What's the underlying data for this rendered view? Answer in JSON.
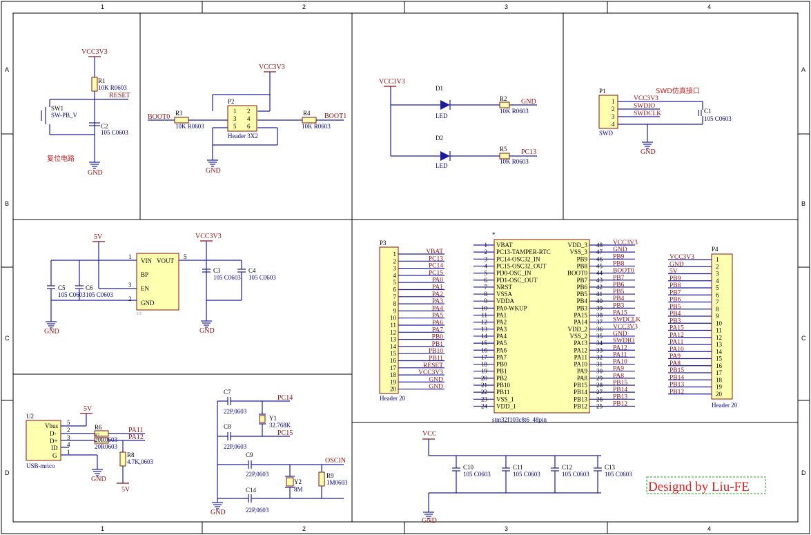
{
  "frame": {
    "cols": [
      "1",
      "2",
      "3",
      "4"
    ],
    "rows": [
      "A",
      "B",
      "C",
      "D"
    ]
  },
  "reset": {
    "vcc": "VCC3V3",
    "r_des": "R1",
    "r_val": "10K R0603",
    "net": "RESET",
    "sw_des": "SW1",
    "sw_val": "SW-PB_V",
    "c_des": "C2",
    "c_val": "105 C0603",
    "label": "复位电路",
    "gnd": "GND"
  },
  "boot": {
    "vcc": "VCC3V3",
    "net0": "BOOT0",
    "r3_des": "R3",
    "r3_val": "10K R0603",
    "p2_des": "P2",
    "p2_val": "Header 3X2",
    "pins": [
      "1",
      "2",
      "3",
      "4",
      "5",
      "6"
    ],
    "r4_des": "R4",
    "r4_val": "10K R0603",
    "net1": "BOOT1",
    "gnd": "GND"
  },
  "leds": {
    "vcc": "VCC3V3",
    "d1_des": "D1",
    "d1_val": "LED",
    "r2_des": "R2",
    "r2_val": "10K R0603",
    "r2_net": "GND",
    "d2_des": "D2",
    "d2_val": "LED",
    "r5_des": "R5",
    "r5_val": "10K R0603",
    "r5_net": "PC13"
  },
  "swd": {
    "title": "SWD仿真接口",
    "p1_des": "P1",
    "p1_val": "SWD",
    "pins": [
      "1",
      "2",
      "3",
      "4"
    ],
    "nets": [
      "VCC3V3",
      "SWDIO",
      "SWDCLK"
    ],
    "c1_des": "C1",
    "c1_val": "105 C0603",
    "gnd": "GND"
  },
  "ldo": {
    "v5": "5V",
    "vcc": "VCC3V3",
    "pin_vin": "VIN",
    "pin_vout": "VOUT",
    "pin_bp": "BP",
    "pin_en": "EN",
    "pin_gnd": "GND",
    "pin1": "1",
    "pin2": "2",
    "pin3": "3",
    "pin5": "5",
    "c5_des": "C5",
    "c5_val": "105 C0603",
    "c6_des": "C6",
    "c6_val": "105 C0603",
    "c3_des": "C3",
    "c3_val": "105 C0603",
    "c4_des": "C4",
    "c4_val": "105 C0603",
    "gnd": "GND",
    "u1": "U1"
  },
  "usb": {
    "u2_des": "U2",
    "u2_val": "USB-mrico",
    "pins": [
      "Vbus",
      "D-",
      "D+",
      "ID",
      "G"
    ],
    "pinnums": [
      "5",
      "2",
      "3",
      "4",
      "1"
    ],
    "v5": "5V",
    "r6_des": "R6",
    "r6_val": "20R0603",
    "r7_des": "R7",
    "r7_val": "20R0603",
    "pa11": "PA11",
    "pa12": "PA12",
    "r8_des": "R8",
    "r8_val": "4.7K,0603",
    "v5b": "5V",
    "gnd": "GND"
  },
  "xtal": {
    "c7_des": "C7",
    "c7_val": "22P,0603",
    "c8_des": "C8",
    "c8_val": "22P,0603",
    "y1_des": "Y1",
    "y1_val": "32.768K",
    "pc14": "PC14",
    "pc15": "PC15",
    "c9_des": "C9",
    "c9_val": "22P,0603",
    "c14_des": "C14",
    "c14_val": "22P,0603",
    "y2_des": "Y2",
    "y2_val": "8M",
    "r9_des": "R9",
    "r9_val": "1M0603",
    "oscin": "OSCIN",
    "gnd": "GND"
  },
  "p3": {
    "des": "P3",
    "val": "Header 20",
    "pins": [
      "1",
      "2",
      "3",
      "4",
      "5",
      "6",
      "7",
      "8",
      "9",
      "10",
      "11",
      "12",
      "13",
      "14",
      "15",
      "16",
      "17",
      "18",
      "19",
      "20"
    ],
    "nets": [
      "VBAT",
      "PC13",
      "PC14",
      "PC15",
      "PA0",
      "PA1",
      "PA2",
      "PA3",
      "PA4",
      "PA5",
      "PA6",
      "PA7",
      "PB0",
      "PB1",
      "PB10",
      "PB11",
      "RESET",
      "VCC3V3",
      "GND",
      "GND"
    ]
  },
  "mcu": {
    "val": "stm32f103c8t6_48pin",
    "left_nums": [
      "1",
      "2",
      "3",
      "4",
      "5",
      "6",
      "7",
      "8",
      "9",
      "10",
      "11",
      "12",
      "13",
      "14",
      "15",
      "16",
      "17",
      "18",
      "19",
      "20",
      "21",
      "22",
      "23",
      "24"
    ],
    "left_pins": [
      "VBAT",
      "PC13-TAMPER-RTC",
      "PC14-OSC32_IN",
      "PC15-OSC32_OUT",
      "PD0-OSC_IN",
      "PD1-OSC_OUT",
      "NRST",
      "VSSA",
      "VDDA",
      "PA0-WKUP",
      "PA1",
      "PA2",
      "PA3",
      "PA4",
      "PA5",
      "PA6",
      "PA7",
      "PB0",
      "PB1",
      "PB2",
      "PB10",
      "PB11",
      "VSS_1",
      "VDD_1"
    ],
    "right_pins": [
      "VDD_3",
      "VSS_3",
      "PB9",
      "PB8",
      "BOOT0",
      "PB7",
      "PB6",
      "PB5",
      "PB4",
      "PB3",
      "PA15",
      "PA14",
      "VDD_2",
      "VSS_2",
      "PA13",
      "PA12",
      "PA11",
      "PA10",
      "PA9",
      "PA8",
      "PB15",
      "PB14",
      "PB13",
      "PB12"
    ],
    "right_nums": [
      "48",
      "47",
      "46",
      "45",
      "44",
      "43",
      "42",
      "41",
      "40",
      "39",
      "38",
      "37",
      "36",
      "35",
      "34",
      "33",
      "32",
      "31",
      "30",
      "29",
      "28",
      "27",
      "26",
      "25"
    ],
    "right_nets": [
      "VCC3V3",
      "GND",
      "PB9",
      "PB8",
      "BOOT0",
      "PB7",
      "PB6",
      "PB5",
      "PB4",
      "PB3",
      "PA15",
      "SWDCLK",
      "VCC3V3",
      "GND",
      "SWDIO",
      "PA12",
      "PA11",
      "PA10",
      "PA9",
      "PA8",
      "PB15",
      "PB14",
      "PB13",
      "PB12"
    ]
  },
  "p4": {
    "des": "P4",
    "val": "Header 20",
    "pins": [
      "1",
      "2",
      "3",
      "4",
      "5",
      "6",
      "7",
      "8",
      "9",
      "10",
      "11",
      "12",
      "13",
      "14",
      "15",
      "16",
      "17",
      "18",
      "19",
      "20"
    ],
    "nets": [
      "VCC3V3",
      "GND",
      "5V",
      "PB9",
      "PB8",
      "PB7",
      "PB6",
      "PB5",
      "PB4",
      "PB3",
      "PA15",
      "PA12",
      "PA11",
      "PA10",
      "PA9",
      "PA8",
      "PB15",
      "PB14",
      "PB13",
      "PB12"
    ]
  },
  "decap": {
    "vcc": "VCC",
    "caps": [
      {
        "des": "C10",
        "val": "105 C0603"
      },
      {
        "des": "C11",
        "val": "105 C0603"
      },
      {
        "des": "C12",
        "val": "105 C0603"
      },
      {
        "des": "C13",
        "val": "105 C0603"
      }
    ],
    "gnd": "GND"
  },
  "credit": "Designd by Liu-FE",
  "colors": {
    "wire": "#1a1aa0",
    "net": "#8a1010",
    "part": "#ffffb0",
    "credit": "#e02020"
  }
}
